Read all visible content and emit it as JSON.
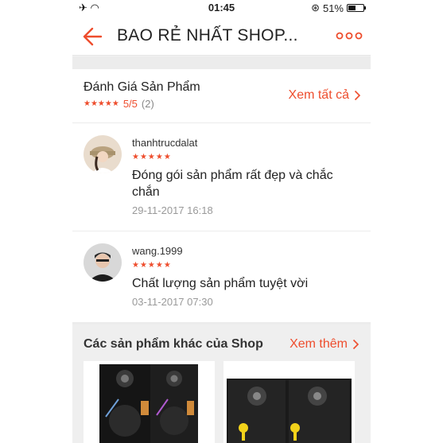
{
  "status_bar": {
    "time": "01:45",
    "battery": "51%",
    "battery_level": 0.51
  },
  "nav": {
    "title": "BAO RẺ NHẤT SHOP..."
  },
  "reviews": {
    "title": "Đánh Giá Sản Phẩm",
    "rating": "5/5",
    "rating_count": "(2)",
    "stars": "★★★★★",
    "view_all": "Xem tất cả",
    "items": [
      {
        "username": "thanhtrucdalat",
        "stars": "★★★★★",
        "comment": "Đóng gói sản phẩm rất đẹp và chắc chắn",
        "date": "29-11-2017 16:18"
      },
      {
        "username": "wang.1999",
        "stars": "★★★★★",
        "comment": "Chất lượng sản phẩm tuyệt vời",
        "date": "03-11-2017 07:30"
      }
    ]
  },
  "other_products": {
    "title": "Các sản phẩm khác của Shop",
    "see_more": "Xem thêm"
  },
  "colors": {
    "accent": "#ee4d2d",
    "background": "#f2f2f2"
  }
}
